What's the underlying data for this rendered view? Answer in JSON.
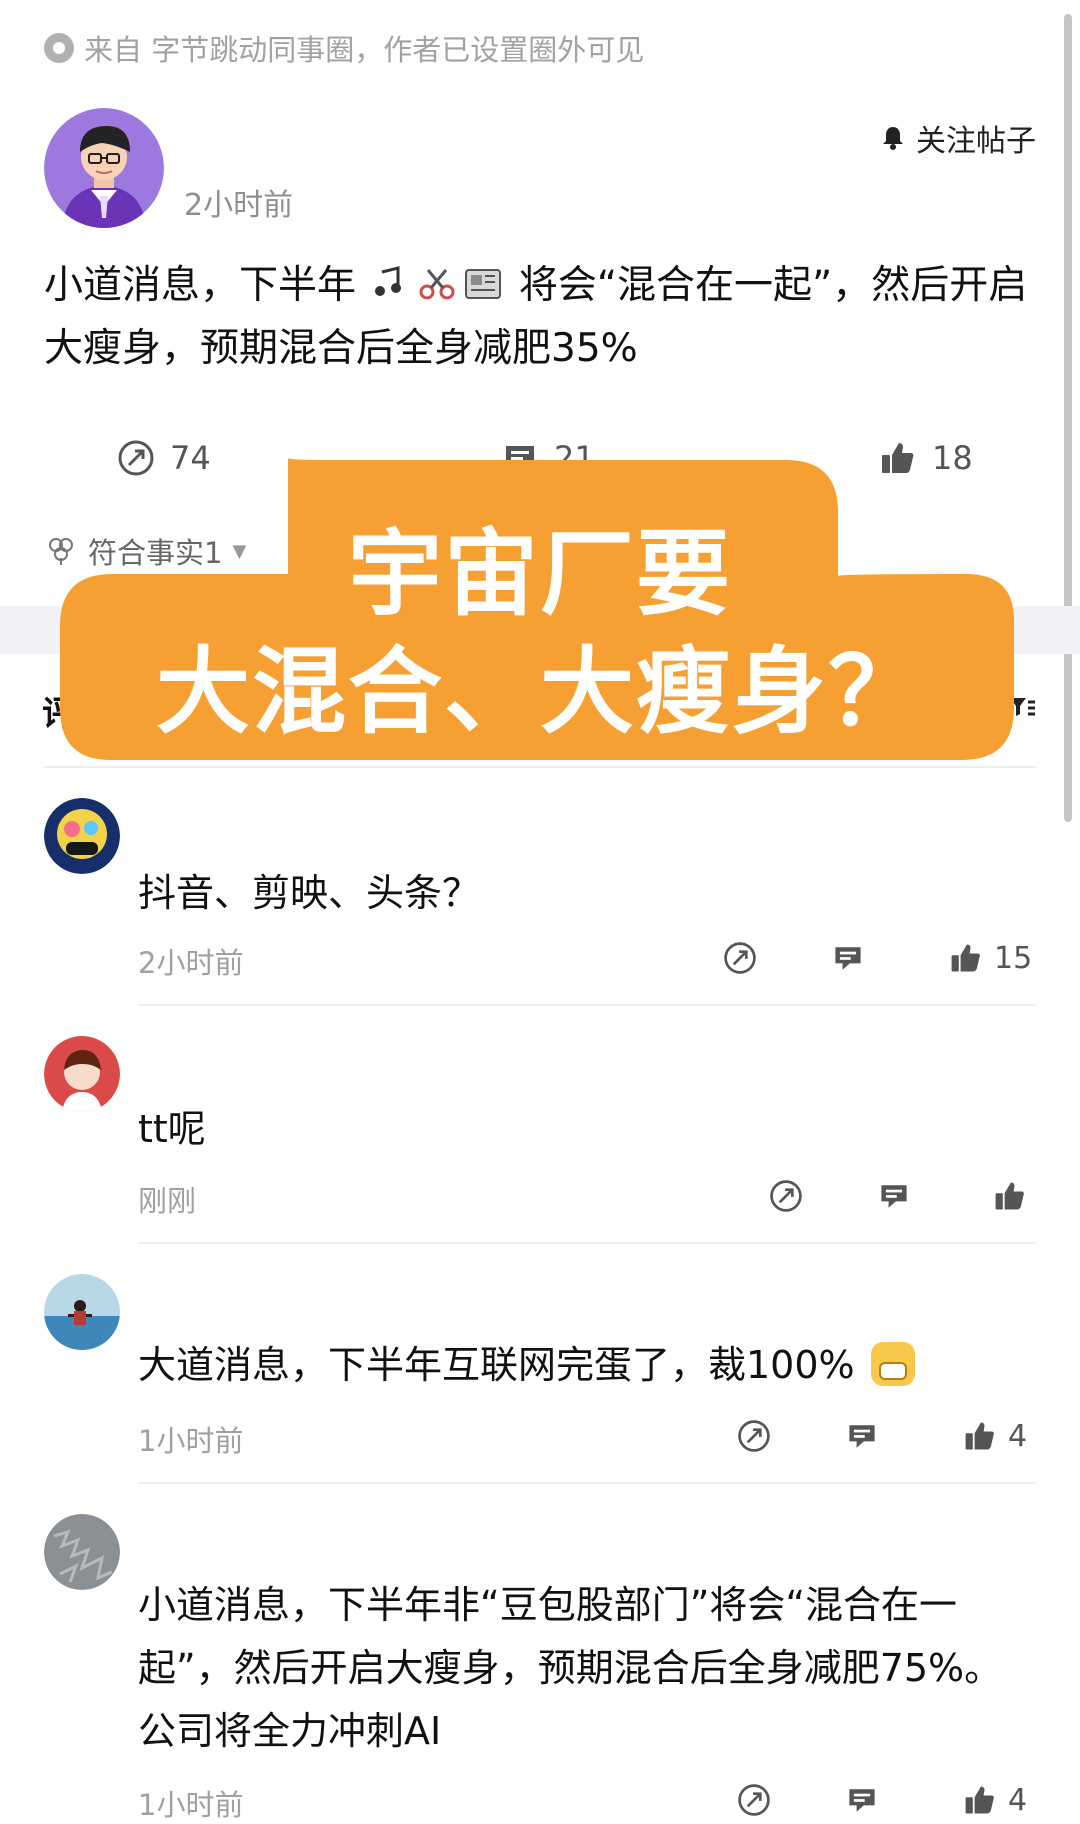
{
  "source": {
    "text": "来自 字节跳动同事圈，作者已设置圈外可见",
    "icon": "circle-dot-icon"
  },
  "post": {
    "author_name": "",
    "time": "2小时前",
    "follow_label": "关注帖子",
    "text_before": "小道消息，下半年",
    "text_after": "将会“混合在一起”，然后开启大瘦身，预期混合后全身减肥35%",
    "emoji_icons": [
      "music-note-icon",
      "scissors-icon",
      "newspaper-icon"
    ],
    "stats": {
      "share": "74",
      "comments": "21",
      "likes": "18"
    },
    "meta_label": "符合事实1",
    "section_left": "评",
    "section_filter_icon": "filter-icon"
  },
  "overlay": {
    "line1": "宇宙厂要",
    "line2": "大混合、大瘦身？"
  },
  "comments": [
    {
      "name": "",
      "text": "抖音、剪映、头条？",
      "time": "2小时前",
      "likes": "15"
    },
    {
      "name": "",
      "text": "tt呢",
      "time": "刚刚",
      "likes": ""
    },
    {
      "name": "",
      "text": "大道消息，下半年互联网完蛋了，裁100%",
      "time": "1小时前",
      "likes": "4"
    },
    {
      "name": "",
      "text": "小道消息，下半年非“豆包股部门”将会“混合在一起”，然后开启大瘦身，预期混合后全身减肥75%。公司将全力冲刺AI",
      "time": "1小时前",
      "likes": "4"
    }
  ],
  "colors": {
    "overlay": "#f6a033",
    "band": "#f1f2f7"
  }
}
